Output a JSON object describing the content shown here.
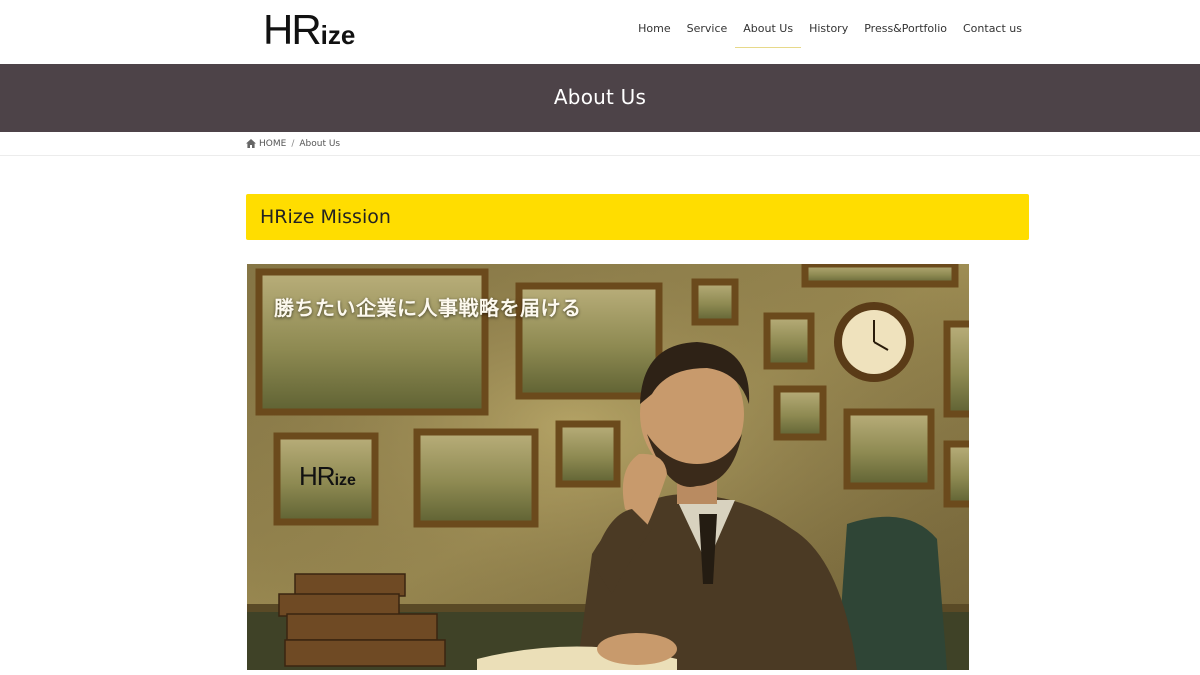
{
  "header": {
    "logo_main": "HR",
    "logo_sub": "ize",
    "nav": [
      {
        "label": "Home"
      },
      {
        "label": "Service"
      },
      {
        "label": "About Us"
      },
      {
        "label": "History"
      },
      {
        "label": "Press&Portfolio"
      },
      {
        "label": "Contact us"
      }
    ],
    "active_nav": "About Us"
  },
  "page_title": "About Us",
  "breadcrumb": {
    "home_icon": "home-icon",
    "home_label": "HOME",
    "separator": "/",
    "current": "About Us"
  },
  "mission": {
    "heading": "HRize Mission",
    "heading_bg": "#ffdd00"
  },
  "hero": {
    "caption": "勝ちたい企業に人事戦略を届ける",
    "logo_main": "HR",
    "logo_sub": "ize"
  },
  "colors": {
    "title_band": "#4d4348",
    "accent": "#ffdd00"
  }
}
